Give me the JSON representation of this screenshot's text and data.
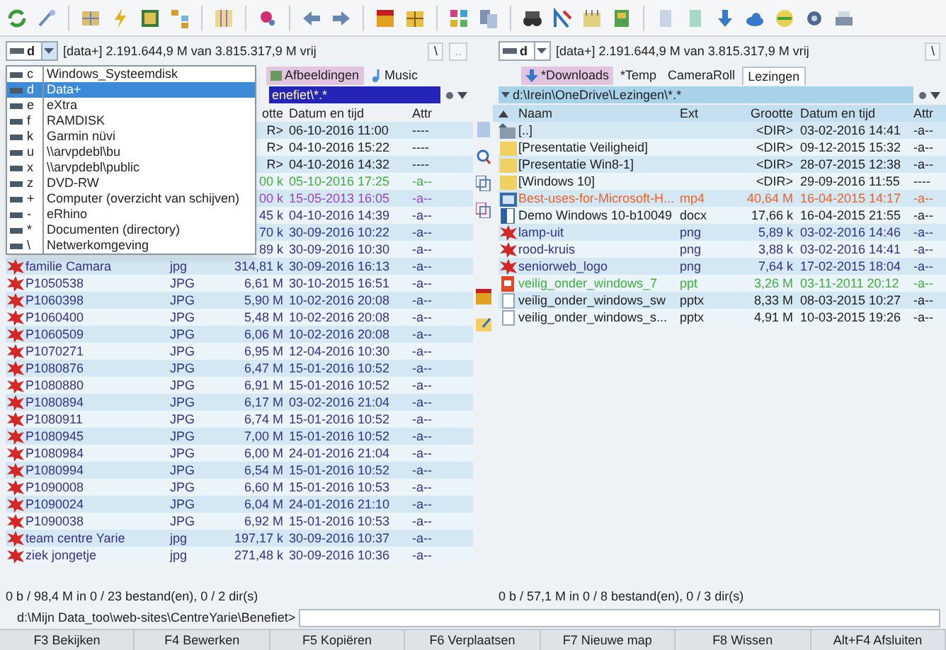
{
  "left_panel": {
    "drive": {
      "letter": "d",
      "info": "[data+] 2.191.644,9 M van 3.815.317,9 M vrij",
      "buttons": [
        "\\",
        ".."
      ]
    },
    "tabs": [
      {
        "label": "Afbeeldingen",
        "selected": false
      },
      {
        "label": "Music",
        "selected": false
      }
    ],
    "path": "enefiet\\*.*",
    "columns": [
      "otte",
      "Datum en tijd",
      "Attr"
    ],
    "rows": [
      {
        "size": "R>",
        "date": "06-10-2016 11:00",
        "attr": "----",
        "color": "#1e1e1e"
      },
      {
        "size": "R>",
        "date": "04-10-2016 15:22",
        "attr": "----",
        "color": "#1e1e1e"
      },
      {
        "size": "R>",
        "date": "04-10-2016 14:32",
        "attr": "----",
        "color": "#1e1e1e"
      },
      {
        "size": "00 k",
        "date": "05-10-2016 17:25",
        "attr": "-a--",
        "color": "#3fae3f"
      },
      {
        "size": "00 k",
        "date": "15-05-2013 16:05",
        "attr": "-a--",
        "color": "#9a44c8"
      },
      {
        "size": "45 k",
        "date": "04-10-2016 14:39",
        "attr": "-a--",
        "color": "#35308a"
      },
      {
        "size": "70 k",
        "date": "30-09-2016 10:22",
        "attr": "-a--",
        "color": "#35308a"
      },
      {
        "size": "89 k",
        "date": "30-09-2016 10:30",
        "attr": "-a--",
        "color": "#35308a"
      },
      {
        "kind": "image",
        "name": "familie Camara",
        "ext": "jpg",
        "size": "314,81 k",
        "date": "30-09-2016 16:13",
        "attr": "-a--",
        "color": "#35308a"
      },
      {
        "kind": "image",
        "name": "P1050538",
        "ext": "JPG",
        "size": "6,61 M",
        "date": "30-10-2015 16:51",
        "attr": "-a--",
        "color": "#35308a"
      },
      {
        "kind": "image",
        "name": "P1060398",
        "ext": "JPG",
        "size": "5,90 M",
        "date": "10-02-2016 20:08",
        "attr": "-a--",
        "color": "#35308a"
      },
      {
        "kind": "image",
        "name": "P1060400",
        "ext": "JPG",
        "size": "5,48 M",
        "date": "10-02-2016 20:08",
        "attr": "-a--",
        "color": "#35308a"
      },
      {
        "kind": "image",
        "name": "P1060509",
        "ext": "JPG",
        "size": "6,06 M",
        "date": "10-02-2016 20:08",
        "attr": "-a--",
        "color": "#35308a"
      },
      {
        "kind": "image",
        "name": "P1070271",
        "ext": "JPG",
        "size": "6,95 M",
        "date": "12-04-2016 10:30",
        "attr": "-a--",
        "color": "#35308a"
      },
      {
        "kind": "image",
        "name": "P1080876",
        "ext": "JPG",
        "size": "6,47 M",
        "date": "15-01-2016 10:52",
        "attr": "-a--",
        "color": "#35308a"
      },
      {
        "kind": "image",
        "name": "P1080880",
        "ext": "JPG",
        "size": "6,91 M",
        "date": "15-01-2016 10:52",
        "attr": "-a--",
        "color": "#35308a"
      },
      {
        "kind": "image",
        "name": "P1080894",
        "ext": "JPG",
        "size": "6,17 M",
        "date": "03-02-2016 21:04",
        "attr": "-a--",
        "color": "#35308a"
      },
      {
        "kind": "image",
        "name": "P1080911",
        "ext": "JPG",
        "size": "6,74 M",
        "date": "15-01-2016 10:52",
        "attr": "-a--",
        "color": "#35308a"
      },
      {
        "kind": "image",
        "name": "P1080945",
        "ext": "JPG",
        "size": "7,00 M",
        "date": "15-01-2016 10:52",
        "attr": "-a--",
        "color": "#35308a"
      },
      {
        "kind": "image",
        "name": "P1080984",
        "ext": "JPG",
        "size": "6,00 M",
        "date": "24-01-2016 21:04",
        "attr": "-a--",
        "color": "#35308a"
      },
      {
        "kind": "image",
        "name": "P1080994",
        "ext": "JPG",
        "size": "6,54 M",
        "date": "15-01-2016 10:52",
        "attr": "-a--",
        "color": "#35308a"
      },
      {
        "kind": "image",
        "name": "P1090008",
        "ext": "JPG",
        "size": "6,60 M",
        "date": "15-01-2016 10:53",
        "attr": "-a--",
        "color": "#35308a"
      },
      {
        "kind": "image",
        "name": "P1090024",
        "ext": "JPG",
        "size": "6,04 M",
        "date": "24-01-2016 21:10",
        "attr": "-a--",
        "color": "#35308a"
      },
      {
        "kind": "image",
        "name": "P1090038",
        "ext": "JPG",
        "size": "6,92 M",
        "date": "15-01-2016 10:53",
        "attr": "-a--",
        "color": "#35308a"
      },
      {
        "kind": "image",
        "name": "team centre Yarie",
        "ext": "jpg",
        "size": "197,17 k",
        "date": "30-09-2016 10:37",
        "attr": "-a--",
        "color": "#35308a"
      },
      {
        "kind": "image",
        "name": "ziek jongetje",
        "ext": "jpg",
        "size": "271,48 k",
        "date": "30-09-2016 10:36",
        "attr": "-a--",
        "color": "#35308a"
      }
    ],
    "status": "0 b / 98,4 M in 0 / 23 bestand(en), 0 / 2 dir(s)"
  },
  "drive_menu": {
    "items": [
      {
        "letter": "c",
        "label": "Windows_Systeemdisk",
        "selected": false
      },
      {
        "letter": "d",
        "label": "Data+",
        "selected": true
      },
      {
        "letter": "e",
        "label": "eXtra",
        "selected": false
      },
      {
        "letter": "f",
        "label": "RAMDISK",
        "selected": false
      },
      {
        "letter": "k",
        "label": "Garmin nüvi",
        "selected": false
      },
      {
        "letter": "u",
        "label": "\\\\arvpdebl\\bu",
        "selected": false
      },
      {
        "letter": "x",
        "label": "\\\\arvpdebl\\public",
        "selected": false
      },
      {
        "letter": "z",
        "label": "DVD-RW",
        "selected": false
      },
      {
        "letter": "+",
        "label": "Computer (overzicht van schijven)",
        "selected": false
      },
      {
        "letter": "-",
        "label": "eRhino",
        "selected": false
      },
      {
        "letter": "*",
        "label": "Documenten (directory)",
        "selected": false
      },
      {
        "letter": "\\",
        "label": "Netwerkomgeving",
        "selected": false
      }
    ]
  },
  "right_panel": {
    "drive": {
      "letter": "d",
      "info": "[data+] 2.191.644,9 M van 3.815.317,9 M vrij",
      "buttons": [
        "\\"
      ]
    },
    "tabs": [
      {
        "label": "*Downloads",
        "selected": false
      },
      {
        "label": "*Temp",
        "selected": false
      },
      {
        "label": "CameraRoll",
        "selected": false
      },
      {
        "label": "Lezingen",
        "selected": true
      }
    ],
    "path": "d:\\Irein\\OneDrive\\Lezingen\\*.*",
    "columns": [
      "Naam",
      "Ext",
      "Grootte",
      "Datum en tijd",
      "Attr"
    ],
    "rows": [
      {
        "kind": "up",
        "name": "[..]",
        "size": "<DIR>",
        "date": "03-02-2016 14:41",
        "attr": "-a--",
        "color": "#1e1e1e"
      },
      {
        "kind": "folder",
        "name": "[Presentatie Veiligheid]",
        "size": "<DIR>",
        "date": "09-12-2015 15:32",
        "attr": "-a--",
        "color": "#1e1e1e"
      },
      {
        "kind": "folder",
        "name": "[Presentatie Win8-1]",
        "size": "<DIR>",
        "date": "28-07-2015 12:38",
        "attr": "-a--",
        "color": "#1e1e1e"
      },
      {
        "kind": "folder",
        "name": "[Windows 10]",
        "size": "<DIR>",
        "date": "29-09-2016 11:55",
        "attr": "----",
        "color": "#1e1e1e"
      },
      {
        "kind": "video",
        "name": "Best-uses-for-Microsoft-H...",
        "ext": "mp4",
        "size": "40,64 M",
        "date": "16-04-2015 14:17",
        "attr": "-a--",
        "color": "#f0602a"
      },
      {
        "kind": "doc",
        "name": "Demo Windows 10-b10049",
        "ext": "docx",
        "size": "17,66 k",
        "date": "16-04-2015 21:55",
        "attr": "-a--",
        "color": "#1e1e1e"
      },
      {
        "kind": "image",
        "name": "lamp-uit",
        "ext": "png",
        "size": "5,89 k",
        "date": "03-02-2016 14:46",
        "attr": "-a--",
        "color": "#35308a"
      },
      {
        "kind": "image",
        "name": "rood-kruis",
        "ext": "png",
        "size": "3,88 k",
        "date": "03-02-2016 14:41",
        "attr": "-a--",
        "color": "#35308a"
      },
      {
        "kind": "image",
        "name": "seniorweb_logo",
        "ext": "png",
        "size": "7,64 k",
        "date": "17-02-2015 18:04",
        "attr": "-a--",
        "color": "#35308a"
      },
      {
        "kind": "slides",
        "name": "veilig_onder_windows_7",
        "ext": "ppt",
        "size": "3,26 M",
        "date": "03-11-2011 20:12",
        "attr": "-a--",
        "color": "#3fae3f"
      },
      {
        "kind": "file",
        "name": "veilig_onder_windows_sw",
        "ext": "pptx",
        "size": "8,33 M",
        "date": "08-03-2015 10:27",
        "attr": "-a--",
        "color": "#1e1e1e"
      },
      {
        "kind": "file",
        "name": "veilig_onder_windows_s...",
        "ext": "pptx",
        "size": "4,91 M",
        "date": "10-03-2015 19:26",
        "attr": "-a--",
        "color": "#1e1e1e"
      }
    ],
    "status": "0 b / 57,1 M in 0 / 8 bestand(en), 0 / 3 dir(s)"
  },
  "command_line": {
    "prompt": "d:\\Mijn Data_too\\web-sites\\CentreYarie\\Benefiet>"
  },
  "function_keys": [
    "F3 Bekijken",
    "F4 Bewerken",
    "F5 Kopiëren",
    "F6 Verplaatsen",
    "F7 Nieuwe map",
    "F8 Wissen",
    "Alt+F4 Afsluiten"
  ]
}
